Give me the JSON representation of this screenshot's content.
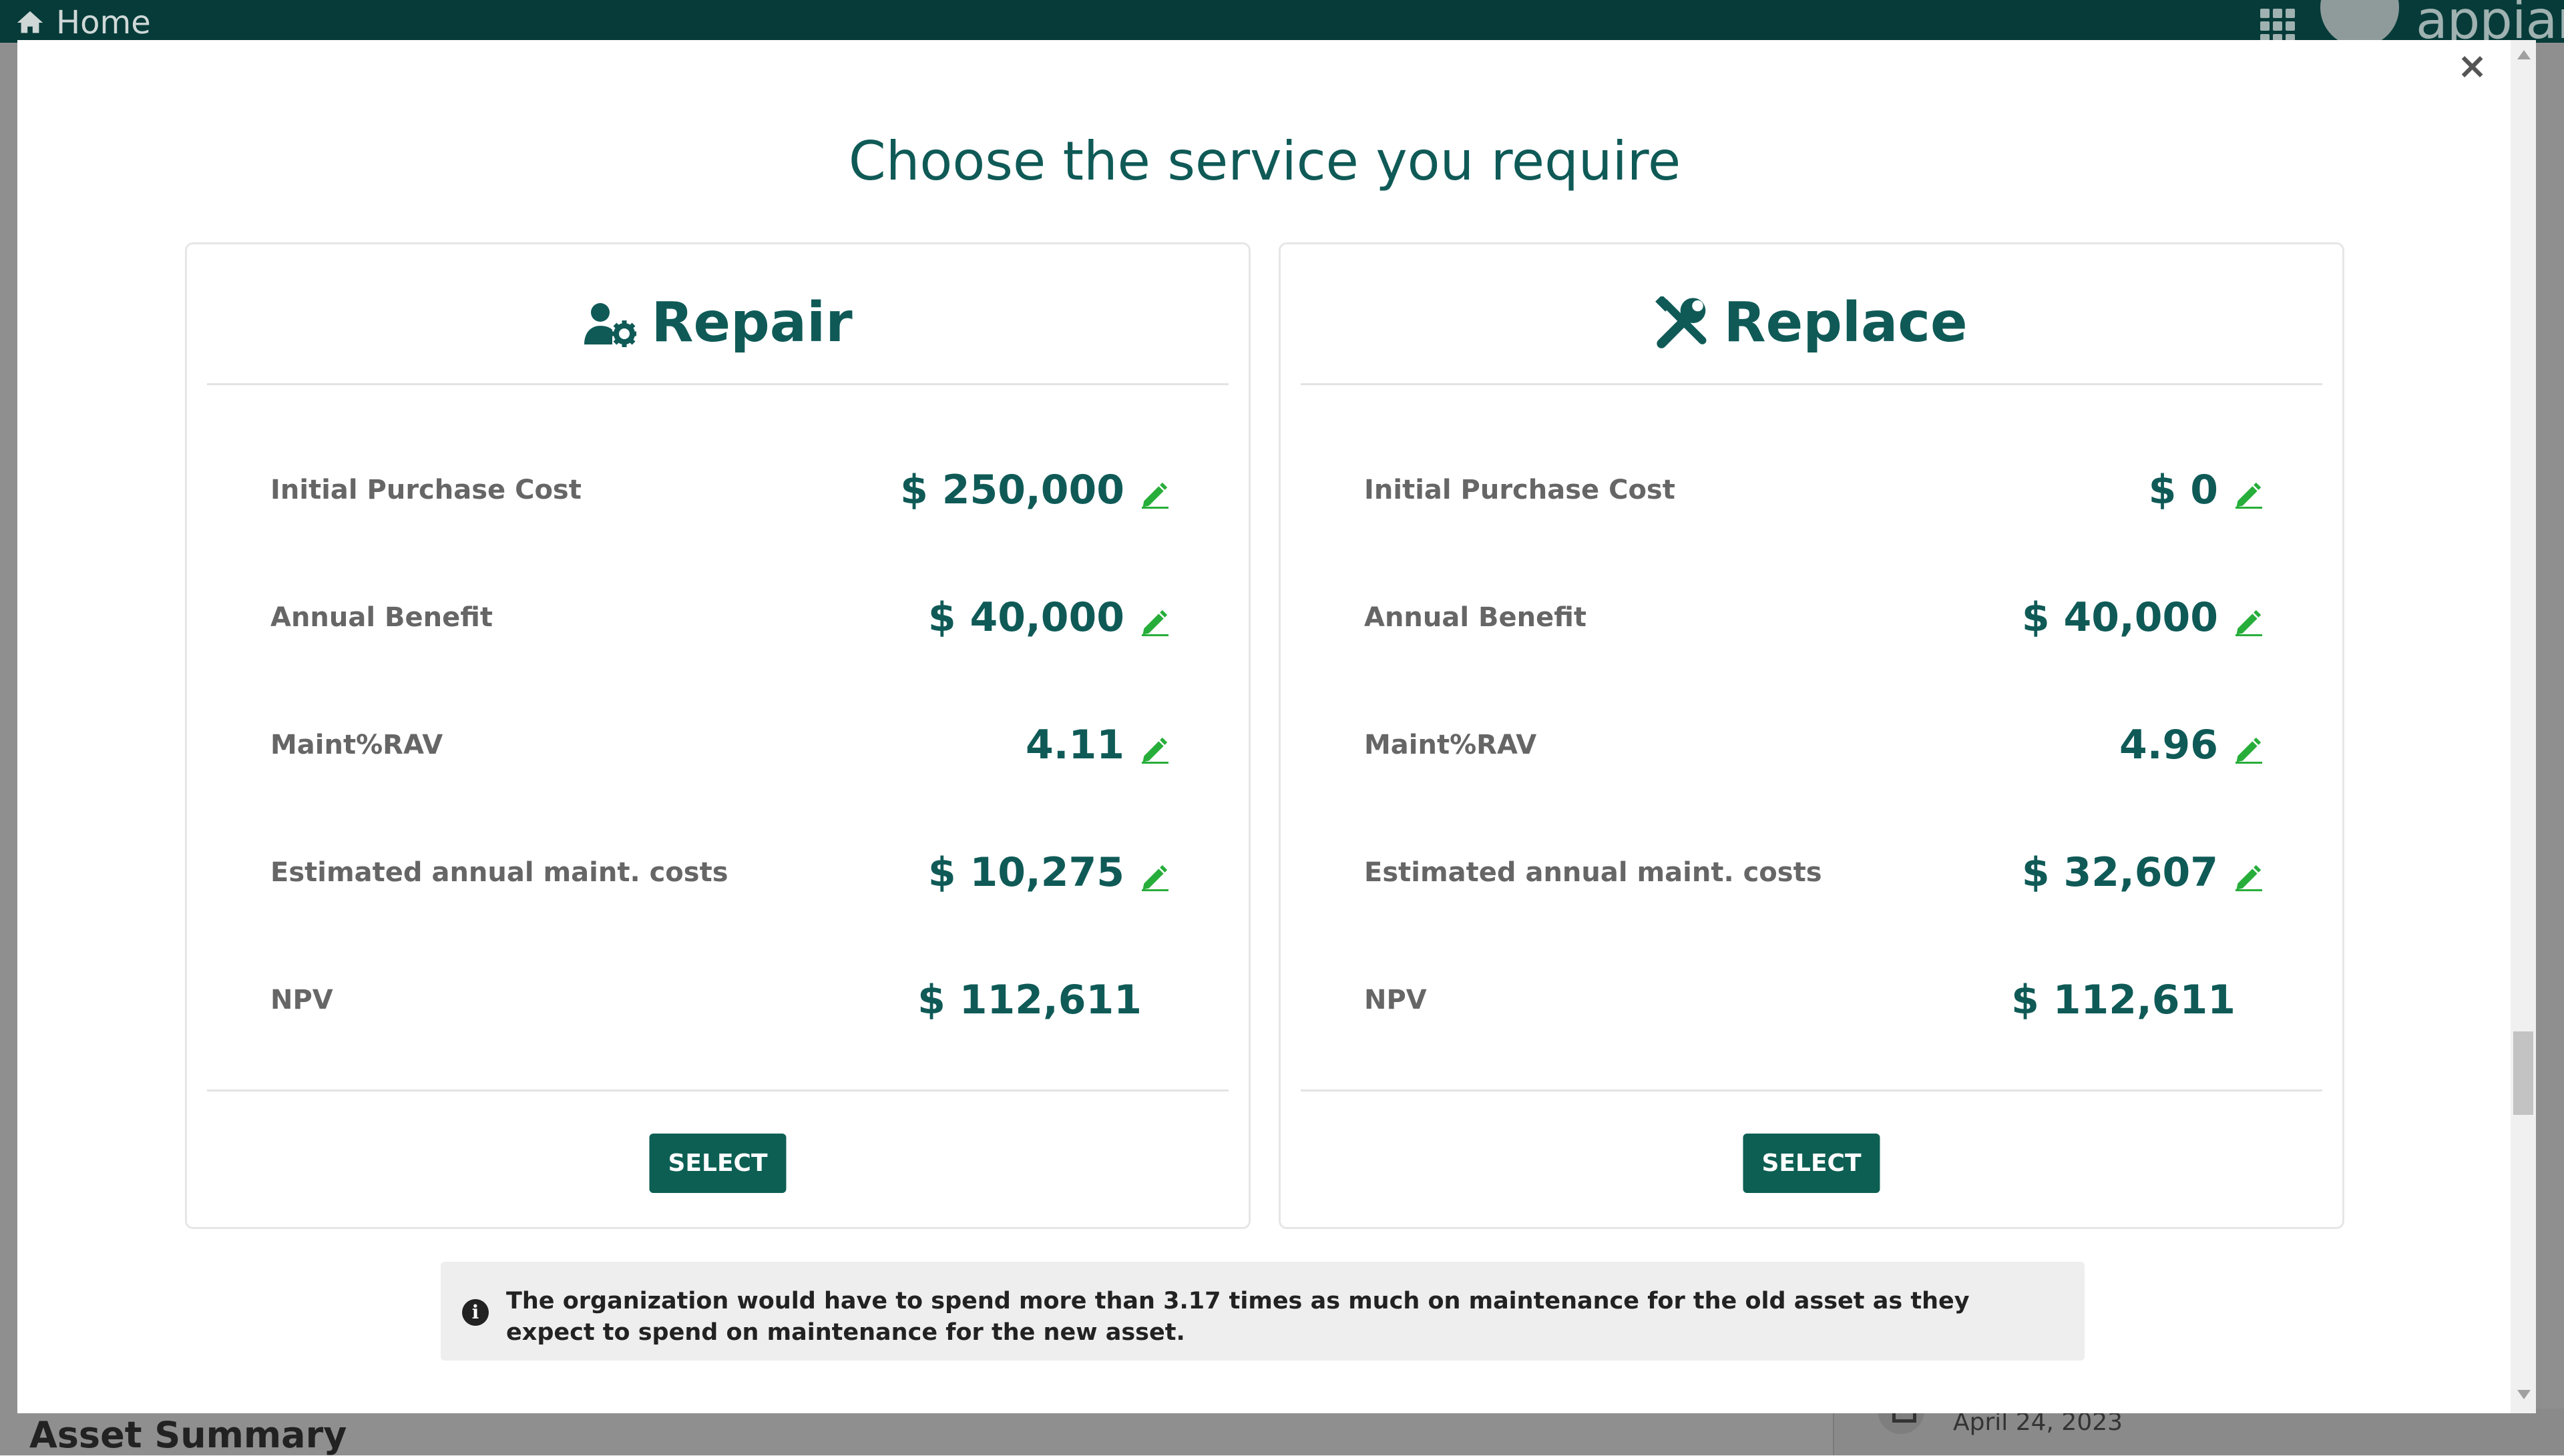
{
  "app": {
    "home_label": "Home",
    "brand": "appian",
    "background_title": "Asset Summary",
    "background_date": "April 24, 2023"
  },
  "modal": {
    "title": "Choose the service you require",
    "close_label": "×",
    "info_icon": "i",
    "info_text": "The organization would have to spend more than 3.17 times as much on maintenance for the old asset as they expect to spend on maintenance for the new asset."
  },
  "repair": {
    "heading": "Repair",
    "icon": "user-gear-icon",
    "rows": [
      {
        "label": "Initial Purchase Cost",
        "value": "$ 250,000",
        "editable": true
      },
      {
        "label": "Annual Benefit",
        "value": "$ 40,000",
        "editable": true
      },
      {
        "label": "Maint%RAV",
        "value": "4.11",
        "editable": true
      },
      {
        "label": "Estimated annual maint. costs",
        "value": "$ 10,275",
        "editable": true
      },
      {
        "label": "NPV",
        "value": "$ 112,611",
        "editable": false
      }
    ],
    "select_label": "SELECT"
  },
  "replace": {
    "heading": "Replace",
    "icon": "tools-icon",
    "rows": [
      {
        "label": "Initial Purchase Cost",
        "value": "$ 0",
        "editable": true
      },
      {
        "label": "Annual Benefit",
        "value": "$ 40,000",
        "editable": true
      },
      {
        "label": "Maint%RAV",
        "value": "4.96",
        "editable": true
      },
      {
        "label": "Estimated annual maint. costs",
        "value": "$ 32,607",
        "editable": true
      },
      {
        "label": "NPV",
        "value": "$ 112,611",
        "editable": false
      }
    ],
    "select_label": "SELECT"
  },
  "colors": {
    "accent": "#0f5a57",
    "edit_icon": "#27ae3a",
    "button": "#0d5f53",
    "topbar": "#063b39"
  }
}
